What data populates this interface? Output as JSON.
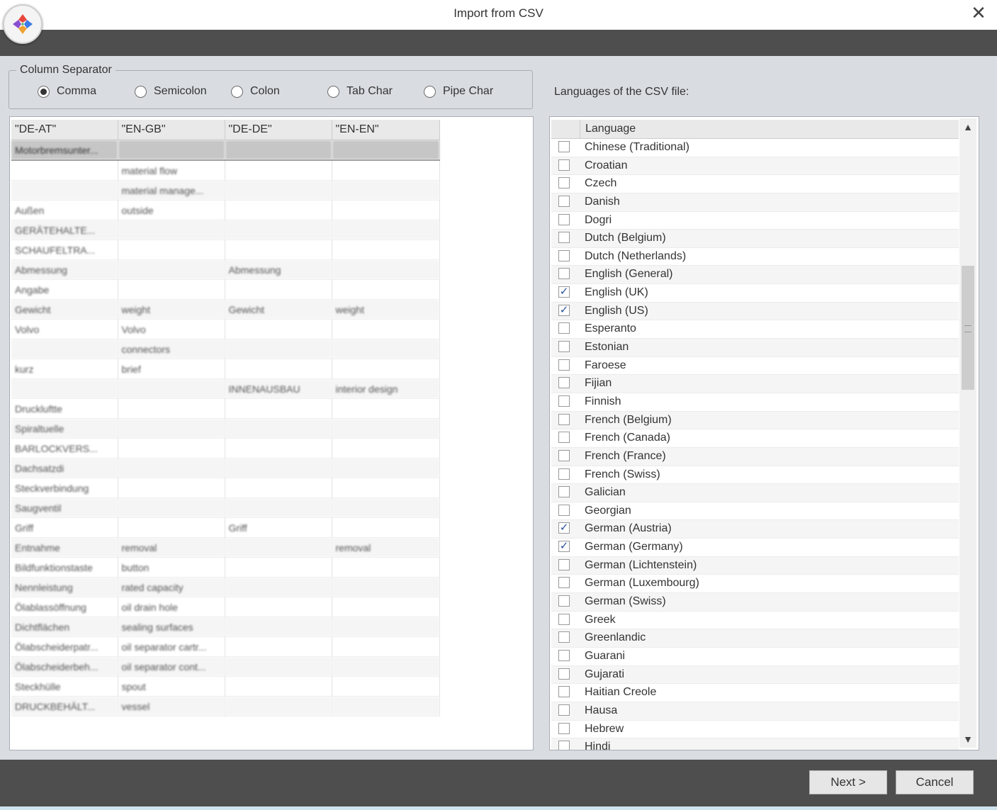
{
  "window": {
    "title": "Import from CSV",
    "close_glyph": "✕"
  },
  "separator": {
    "legend": "Column Separator",
    "options": [
      {
        "label": "Comma",
        "selected": true
      },
      {
        "label": "Semicolon",
        "selected": false
      },
      {
        "label": "Colon",
        "selected": false
      },
      {
        "label": "Tab Char",
        "selected": false
      },
      {
        "label": "Pipe Char",
        "selected": false
      }
    ]
  },
  "languages_label": "Languages of the CSV file:",
  "csv": {
    "columns": [
      "\"DE-AT\"",
      "\"EN-GB\"",
      "\"DE-DE\"",
      "\"EN-EN\""
    ],
    "rows": [
      [
        "Motorbremsunter...",
        "",
        "",
        ""
      ],
      [
        "",
        "material flow",
        "",
        ""
      ],
      [
        "",
        "material manage...",
        "",
        ""
      ],
      [
        "Außen",
        "outside",
        "",
        ""
      ],
      [
        "GERÄTEHALTE...",
        "",
        "",
        ""
      ],
      [
        "SCHAUFELTRA...",
        "",
        "",
        ""
      ],
      [
        "Abmessung",
        "",
        "Abmessung",
        ""
      ],
      [
        "Angabe",
        "",
        "",
        ""
      ],
      [
        "Gewicht",
        "weight",
        "Gewicht",
        "weight"
      ],
      [
        "Volvo",
        "Volvo",
        "",
        ""
      ],
      [
        "",
        "connectors",
        "",
        ""
      ],
      [
        "kurz",
        "brief",
        "",
        ""
      ],
      [
        "",
        "",
        "INNENAUSBAU",
        "interior design"
      ],
      [
        "Druckluftte",
        "",
        "",
        ""
      ],
      [
        "Spiraltuelle",
        "",
        "",
        ""
      ],
      [
        "BARLOCKVERS...",
        "",
        "",
        ""
      ],
      [
        "Dachsatzdi",
        "",
        "",
        ""
      ],
      [
        "Steckverbindung",
        "",
        "",
        ""
      ],
      [
        "Saugventil",
        "",
        "",
        ""
      ],
      [
        "Griff",
        "",
        "Griff",
        ""
      ],
      [
        "Entnahme",
        "removal",
        "",
        "removal"
      ],
      [
        "Bildfunktionstaste",
        "button",
        "",
        ""
      ],
      [
        "Nennleistung",
        "rated capacity",
        "",
        ""
      ],
      [
        "Ölablassöffnung",
        "oil drain hole",
        "",
        ""
      ],
      [
        "Dichtflächen",
        "sealing surfaces",
        "",
        ""
      ],
      [
        "Ölabscheiderpatr...",
        "oil separator cartr...",
        "",
        ""
      ],
      [
        "Ölabscheiderbeh...",
        "oil separator cont...",
        "",
        ""
      ],
      [
        "Steckhülle",
        "spout",
        "",
        ""
      ],
      [
        "DRUCKBEHÄLT...",
        "vessel",
        "",
        ""
      ]
    ]
  },
  "language_list": {
    "header": "Language",
    "items": [
      {
        "name": "Chinese (Traditional)",
        "checked": false
      },
      {
        "name": "Croatian",
        "checked": false
      },
      {
        "name": "Czech",
        "checked": false
      },
      {
        "name": "Danish",
        "checked": false
      },
      {
        "name": "Dogri",
        "checked": false
      },
      {
        "name": "Dutch (Belgium)",
        "checked": false
      },
      {
        "name": "Dutch (Netherlands)",
        "checked": false
      },
      {
        "name": "English (General)",
        "checked": false
      },
      {
        "name": "English (UK)",
        "checked": true
      },
      {
        "name": "English (US)",
        "checked": true
      },
      {
        "name": "Esperanto",
        "checked": false
      },
      {
        "name": "Estonian",
        "checked": false
      },
      {
        "name": "Faroese",
        "checked": false
      },
      {
        "name": "Fijian",
        "checked": false
      },
      {
        "name": "Finnish",
        "checked": false
      },
      {
        "name": "French (Belgium)",
        "checked": false
      },
      {
        "name": "French (Canada)",
        "checked": false
      },
      {
        "name": "French (France)",
        "checked": false
      },
      {
        "name": "French (Swiss)",
        "checked": false
      },
      {
        "name": "Galician",
        "checked": false
      },
      {
        "name": "Georgian",
        "checked": false
      },
      {
        "name": "German (Austria)",
        "checked": true
      },
      {
        "name": "German (Germany)",
        "checked": true
      },
      {
        "name": "German (Lichtenstein)",
        "checked": false
      },
      {
        "name": "German (Luxembourg)",
        "checked": false
      },
      {
        "name": "German (Swiss)",
        "checked": false
      },
      {
        "name": "Greek",
        "checked": false
      },
      {
        "name": "Greenlandic",
        "checked": false
      },
      {
        "name": "Guarani",
        "checked": false
      },
      {
        "name": "Gujarati",
        "checked": false
      },
      {
        "name": "Haitian Creole",
        "checked": false
      },
      {
        "name": "Hausa",
        "checked": false
      },
      {
        "name": "Hebrew",
        "checked": false
      },
      {
        "name": "Hindi",
        "checked": false
      }
    ]
  },
  "buttons": {
    "next": "Next >",
    "cancel": "Cancel"
  },
  "colors": {
    "chrome_dark": "#4e4e4e",
    "background": "#d9dde2",
    "selected_row": "#c6c6c6",
    "check": "#2a4f9a"
  }
}
